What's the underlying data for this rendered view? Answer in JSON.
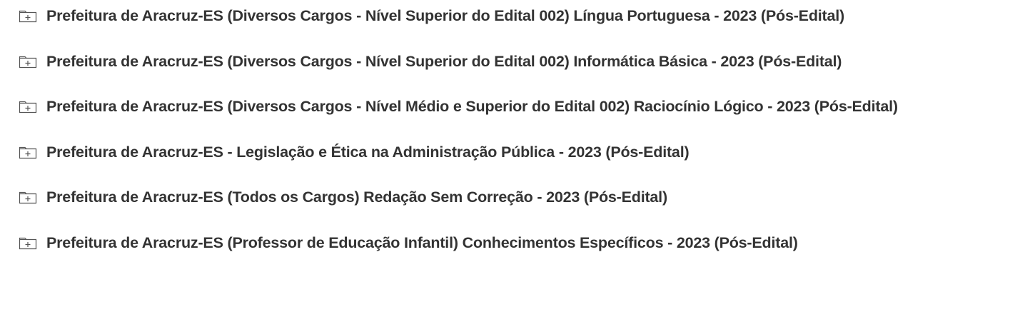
{
  "courses": [
    {
      "title": "Prefeitura de Aracruz-ES (Diversos Cargos - Nível Superior do Edital 002) Língua Portuguesa - 2023 (Pós-Edital)",
      "icon": "folder-plus-icon"
    },
    {
      "title": "Prefeitura de Aracruz-ES (Diversos Cargos - Nível Superior do Edital 002) Informática Básica - 2023 (Pós-Edital)",
      "icon": "folder-plus-icon"
    },
    {
      "title": "Prefeitura de Aracruz-ES (Diversos Cargos - Nível Médio e Superior do Edital 002) Raciocínio Lógico - 2023 (Pós-Edital)",
      "icon": "folder-plus-icon"
    },
    {
      "title": "Prefeitura de Aracruz-ES - Legislação e Ética na Administração Pública - 2023 (Pós-Edital)",
      "icon": "folder-plus-icon"
    },
    {
      "title": "Prefeitura de Aracruz-ES (Todos os Cargos) Redação Sem Correção - 2023 (Pós-Edital)",
      "icon": "folder-plus-icon"
    },
    {
      "title": "Prefeitura de Aracruz-ES (Professor de Educação Infantil) Conhecimentos Específicos - 2023 (Pós-Edital)",
      "icon": "folder-plus-icon"
    }
  ],
  "colors": {
    "text": "#333333",
    "icon_stroke": "#555555"
  }
}
